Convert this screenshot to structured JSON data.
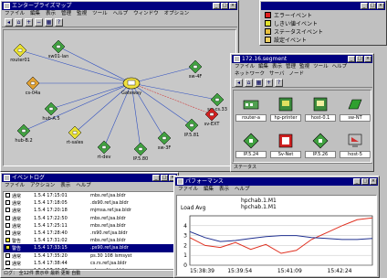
{
  "map_window": {
    "title": "エンタープライズマップ",
    "menu": [
      "ファイル",
      "編集",
      "表示",
      "管理",
      "監視",
      "ツール",
      "ヘルプ",
      "ウィンドウ",
      "オプション"
    ],
    "status": ""
  },
  "map": {
    "center": "Gateway",
    "nodes": [
      {
        "label": "router01",
        "color": "#e8e030",
        "shape": "diamond"
      },
      {
        "label": "sw01-lan",
        "color": "#40a040",
        "shape": "diamond"
      },
      {
        "label": "cs-04a",
        "color": "#e0a030",
        "shape": "diamond"
      },
      {
        "label": "hub-A.5",
        "color": "#40a040",
        "shape": "diamond"
      },
      {
        "label": "hub-B.2",
        "color": "#40a040",
        "shape": "diamond"
      },
      {
        "label": "rt-sales",
        "color": "#e8e030",
        "shape": "diamond"
      },
      {
        "label": "rt-dev",
        "color": "#40a040",
        "shape": "diamond"
      },
      {
        "label": "IP.5.80",
        "color": "#40a040",
        "shape": "diamond"
      },
      {
        "label": "sw-3F",
        "color": "#40a040",
        "shape": "diamond"
      },
      {
        "label": "IP.5.81",
        "color": "#40a040",
        "shape": "diamond"
      },
      {
        "label": "sw-cs.33",
        "color": "#40a040",
        "shape": "diamond"
      },
      {
        "label": "sw-4F",
        "color": "#40a040",
        "shape": "diamond"
      },
      {
        "label": "sv-EXT",
        "color": "#d02020",
        "shape": "diamond"
      }
    ]
  },
  "legend_window": {
    "title": "",
    "items": [
      {
        "label": "エラーイベント",
        "color": "#e02020"
      },
      {
        "label": "しきい値イベント",
        "color": "#e0e030"
      },
      {
        "label": "ステータスイベント",
        "color": "#e8c040"
      },
      {
        "label": "設定イベント",
        "color": "#f0d060"
      }
    ]
  },
  "segment_window": {
    "title": "172.16.segment",
    "menu": [
      "ファイル",
      "編集",
      "表示",
      "管理",
      "監視",
      "ツール",
      "ヘルプ"
    ],
    "tabs": [
      "ネットワーク",
      "サーバ",
      "ノード"
    ],
    "devices": [
      {
        "label": "router-a",
        "kind": "router"
      },
      {
        "label": "hp-printer",
        "kind": "printer"
      },
      {
        "label": "host-0.1",
        "kind": "host"
      },
      {
        "label": "sw-NT",
        "kind": "switch"
      },
      {
        "label": "IP.5.24",
        "kind": "diamond"
      },
      {
        "label": "Sv-Net",
        "kind": "server-alert"
      },
      {
        "label": "IP.5.26",
        "kind": "diamond"
      },
      {
        "label": "host-5",
        "kind": "monitor"
      }
    ],
    "status": "ステータス"
  },
  "log_window": {
    "title": "イベントログ",
    "menu": [
      "ファイル",
      "アクション",
      "表示",
      "ヘルプ"
    ],
    "rows": [
      {
        "sev": "#fff",
        "sev_label": "通常",
        "time": "1.5.4 17:15:01",
        "msg": "mbs.ref.jsa.bldr"
      },
      {
        "sev": "#fff",
        "sev_label": "通常",
        "time": "1.5.4 17:18:05",
        "msg": ".ds90.ref.jsa.bldr"
      },
      {
        "sev": "#fff",
        "sev_label": "通常",
        "time": "1.5.4 17:20:18",
        "msg": "mjmsa.ref.jsa.bldr"
      },
      {
        "sev": "#fff",
        "sev_label": "通常",
        "time": "1.5.4 17:22:50",
        "msg": "mbs.ref.jsa.bldr"
      },
      {
        "sev": "#fff",
        "sev_label": "通常",
        "time": "1.5.4 17:25:11",
        "msg": "mbs.ref.jsa.bldr"
      },
      {
        "sev": "#fff",
        "sev_label": "通常",
        "time": "1.5.4 17:28:40",
        "msg": ".rs90.ref.jsa.bldr"
      },
      {
        "sev": "#e8e030",
        "sev_label": "警告",
        "time": "1.5.4 17:31:02",
        "msg": "mbs.ref.jsa.bldr"
      },
      {
        "sev": "#e8e030",
        "sev_label": "警告",
        "time": "1.5.4 17:33:15",
        "msg": ".ps90.ref.jsa.bldr"
      },
      {
        "sev": "#fff",
        "sev_label": "通常",
        "time": "1.5.4 17:35:20",
        "msg": "ps.30 108 lsmsyst"
      },
      {
        "sev": "#fff",
        "sev_label": "通常",
        "time": "1.5.4 17:38:44",
        "msg": "cs.rs.ref.jsa.bldr"
      },
      {
        "sev": "#fff",
        "sev_label": "通常",
        "time": "1.5.4 17:40:07",
        "msg": "mbs.ref.jsa.bldr"
      },
      {
        "sev": "#fff",
        "sev_label": "通常",
        "time": "1.5.4 17:42:31",
        "msg": "mbs.ref.jsa.bldr"
      }
    ],
    "selected_row": 7,
    "status": "ログ：  全12件 表示中 最新 更新 自動"
  },
  "graph_window": {
    "title": "パフォーマンス",
    "menu": [
      "ファイル",
      "編集",
      "表示",
      "ヘルプ"
    ],
    "subtitle": "Load Avg"
  },
  "chart_data": {
    "type": "line",
    "title": "Load Avg",
    "x": [
      "15:38:39",
      "15:39:54",
      "15:41:09",
      "15:42:24"
    ],
    "ylim": [
      0,
      5
    ],
    "yticks": [
      0,
      1,
      2,
      3,
      4
    ],
    "xlabel": "",
    "ylabel": "",
    "series": [
      {
        "name": "hpchab.1.M1",
        "color": "#e03020",
        "values": [
          2.8,
          2.0,
          1.8,
          2.3,
          1.6,
          2.1,
          1.2,
          1.5,
          2.6,
          3.3,
          4.0,
          4.6,
          4.8
        ]
      },
      {
        "name": "hpchab.1.M1",
        "color": "#203090",
        "values": [
          3.4,
          2.8,
          2.4,
          2.5,
          2.7,
          2.9,
          3.0,
          3.0,
          2.8,
          2.7,
          2.6,
          2.6,
          2.7
        ]
      }
    ],
    "legend": "top"
  }
}
